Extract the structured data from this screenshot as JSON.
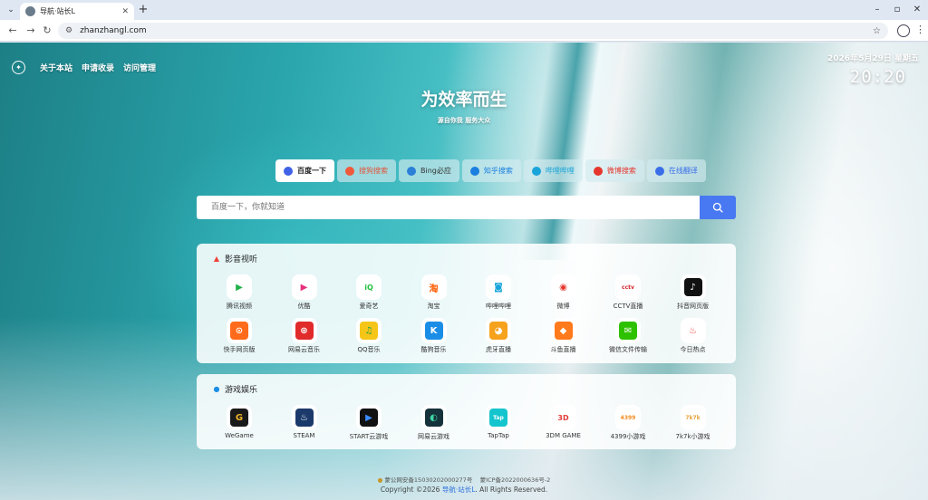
{
  "browser": {
    "tab_title": "导航·站长L",
    "url": "zhanzhangl.com"
  },
  "nav": {
    "links": [
      "关于本站",
      "申请收录",
      "访问管理"
    ]
  },
  "datetime": {
    "date": "2026年5月29日 星期五",
    "time": "20:20"
  },
  "hero": {
    "slogan": "为效率而生",
    "subslogan": "源自你我 服务大众"
  },
  "engines": [
    {
      "label": "百度一下",
      "icon": "baidu-icon",
      "color": "#3f62e6",
      "text_color": "#222"
    },
    {
      "label": "搜狗搜索",
      "icon": "sogou-icon",
      "color": "#f05a3a",
      "text_color": "#e2553a"
    },
    {
      "label": "Bing必应",
      "icon": "bing-icon",
      "color": "#2a7fd6",
      "text_color": "#333"
    },
    {
      "label": "知乎搜索",
      "icon": "zhihu-icon",
      "color": "#1a7fe0",
      "text_color": "#1a7fe0"
    },
    {
      "label": "哔哩哔哩",
      "icon": "bilibili-icon",
      "color": "#19a5d9",
      "text_color": "#19a5d9"
    },
    {
      "label": "微博搜索",
      "icon": "weibo-icon",
      "color": "#e6362d",
      "text_color": "#e6362d"
    },
    {
      "label": "在线翻译",
      "icon": "translate-icon",
      "color": "#3a6ee8",
      "text_color": "#3a6ee8"
    }
  ],
  "search": {
    "placeholder": "百度一下，你就知道"
  },
  "sections": [
    {
      "title": "影音视听",
      "icon": "fire-icon",
      "items": [
        {
          "label": "腾讯视频",
          "icon": "tencent-video-icon",
          "color": "#ffffff",
          "glyph": "▶",
          "glyph_color": "#22b14c"
        },
        {
          "label": "优酷",
          "icon": "youku-icon",
          "color": "#ffffff",
          "glyph": "▶",
          "glyph_color": "#e72f7c"
        },
        {
          "label": "爱奇艺",
          "icon": "iqiyi-icon",
          "color": "#ffffff",
          "glyph": "iQ",
          "glyph_color": "#21c13f"
        },
        {
          "label": "淘宝",
          "icon": "taobao-icon",
          "color": "#ffffff",
          "glyph": "淘",
          "glyph_color": "#ff5a00"
        },
        {
          "label": "哔哩哔哩",
          "icon": "bilibili-icon",
          "color": "#ffffff",
          "glyph": "◙",
          "glyph_color": "#19a5d9"
        },
        {
          "label": "微博",
          "icon": "weibo-icon",
          "color": "#ffffff",
          "glyph": "◉",
          "glyph_color": "#e6362d"
        },
        {
          "label": "CCTV直播",
          "icon": "cctv-icon",
          "color": "#ffffff",
          "glyph": "cctv",
          "glyph_color": "#d8262b"
        },
        {
          "label": "抖音网页版",
          "icon": "douyin-icon",
          "color": "#111111",
          "glyph": "♪",
          "glyph_color": "#ffffff"
        },
        {
          "label": "快手网页版",
          "icon": "kuaishou-icon",
          "color": "#ff6b1a",
          "glyph": "⊙",
          "glyph_color": "#ffffff"
        },
        {
          "label": "网易云音乐",
          "icon": "netease-music-icon",
          "color": "#e12b2b",
          "glyph": "⊛",
          "glyph_color": "#ffffff"
        },
        {
          "label": "QQ音乐",
          "icon": "qq-music-icon",
          "color": "#f5c518",
          "glyph": "♫",
          "glyph_color": "#1fa34a"
        },
        {
          "label": "酷狗音乐",
          "icon": "kugou-icon",
          "color": "#1a8ee6",
          "glyph": "K",
          "glyph_color": "#ffffff"
        },
        {
          "label": "虎牙直播",
          "icon": "huya-icon",
          "color": "#f6a21d",
          "glyph": "◕",
          "glyph_color": "#ffffff"
        },
        {
          "label": "斗鱼直播",
          "icon": "douyu-icon",
          "color": "#ff7a1c",
          "glyph": "◆",
          "glyph_color": "#ffffff"
        },
        {
          "label": "微信文件传输",
          "icon": "wechat-icon",
          "color": "#2dc100",
          "glyph": "✉",
          "glyph_color": "#ffffff"
        },
        {
          "label": "今日热点",
          "icon": "hot-icon",
          "color": "#ffffff",
          "glyph": "♨",
          "glyph_color": "#f0403c"
        }
      ]
    },
    {
      "title": "游戏娱乐",
      "icon": "game-icon",
      "items": [
        {
          "label": "WeGame",
          "icon": "wegame-icon",
          "color": "#1a1a1a",
          "glyph": "G",
          "glyph_color": "#f0b429"
        },
        {
          "label": "STEAM",
          "icon": "steam-icon",
          "color": "#1b3a6b",
          "glyph": "♨",
          "glyph_color": "#ffffff"
        },
        {
          "label": "START云游戏",
          "icon": "start-icon",
          "color": "#111111",
          "glyph": "▶",
          "glyph_color": "#3a8cff"
        },
        {
          "label": "网易云游戏",
          "icon": "netease-game-icon",
          "color": "#16323a",
          "glyph": "◐",
          "glyph_color": "#3fd6a6"
        },
        {
          "label": "TapTap",
          "icon": "taptap-icon",
          "color": "#15c5ce",
          "glyph": "Tap",
          "glyph_color": "#ffffff"
        },
        {
          "label": "3DM GAME",
          "icon": "3dm-icon",
          "color": "#ffffff",
          "glyph": "3D",
          "glyph_color": "#e23a3a"
        },
        {
          "label": "4399小游戏",
          "icon": "4399-icon",
          "color": "#ffffff",
          "glyph": "4399",
          "glyph_color": "#f28c1e"
        },
        {
          "label": "7k7k小游戏",
          "icon": "7k7k-icon",
          "color": "#ffffff",
          "glyph": "7k7k",
          "glyph_color": "#e8a23c"
        }
      ]
    }
  ],
  "footer": {
    "police_record": "蒙公网安备15030202000277号",
    "icp_record": "蒙ICP备2022000636号-2",
    "copyright_prefix": "Copyright ©2026",
    "brand": "导航·站长L",
    "copyright_suffix": ". All Rights Reserved."
  }
}
